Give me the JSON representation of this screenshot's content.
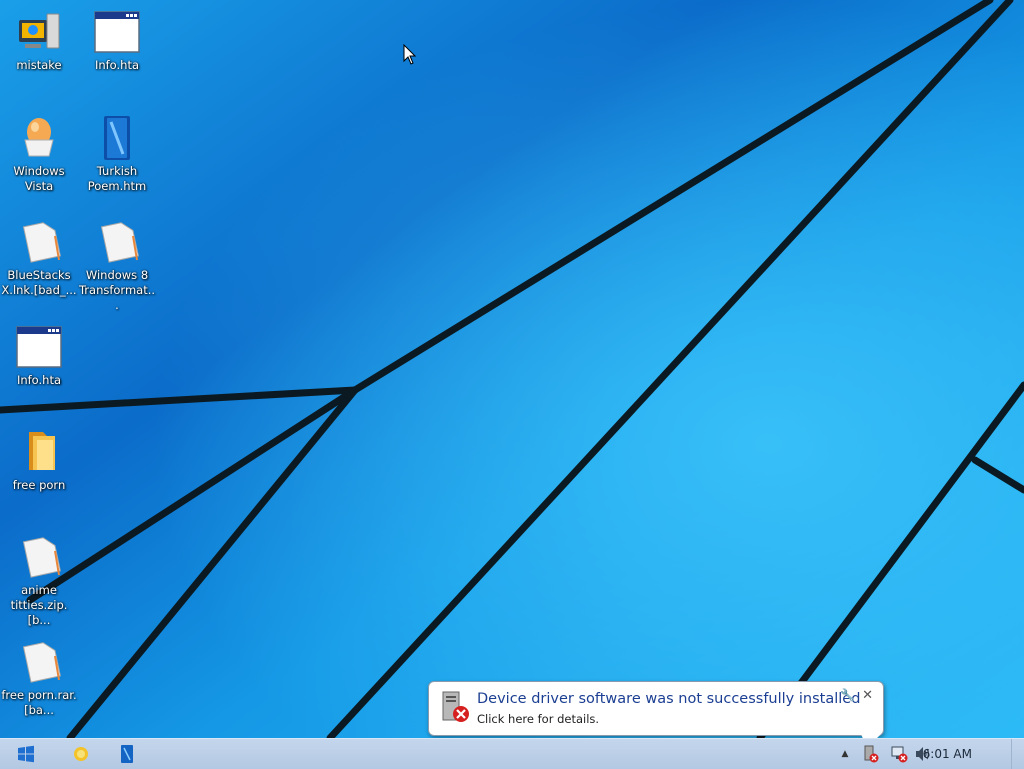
{
  "desktop": {
    "icons": [
      {
        "label": "mistake",
        "icon": "computer-icon"
      },
      {
        "label": "Info.hta",
        "icon": "hta-window-icon"
      },
      {
        "label": "Windows Vista",
        "icon": "egg-icon"
      },
      {
        "label": "Turkish Poem.htm",
        "icon": "blue-book-icon"
      },
      {
        "label": "BlueStacks X.lnk.[bad_...",
        "icon": "blank-file-icon"
      },
      {
        "label": "Windows 8 Transformat...",
        "icon": "blank-file-icon"
      },
      {
        "label": "Info.hta",
        "icon": "hta-window-icon"
      },
      {
        "label": "free porn",
        "icon": "folder-icon"
      },
      {
        "label": "anime titties.zip.[b...",
        "icon": "blank-file-icon"
      },
      {
        "label": "free porn.rar.[ba...",
        "icon": "blank-file-icon"
      }
    ]
  },
  "balloon": {
    "title": "Device driver software was not successfully installed",
    "body": "Click here for details.",
    "close_glyph": "✕",
    "options_glyph": "🔧"
  },
  "taskbar": {
    "clock": "6:01 AM",
    "tray_arrow": "▲",
    "pinned": [
      "start-icon",
      "egg-app-icon",
      "blue-book-app-icon"
    ]
  },
  "colors": {
    "wallpaper_light": "#1aa6f0",
    "wallpaper_dark": "#0a5fbf",
    "taskbar": "#bcd0e8",
    "balloon_title": "#1c3f93"
  }
}
